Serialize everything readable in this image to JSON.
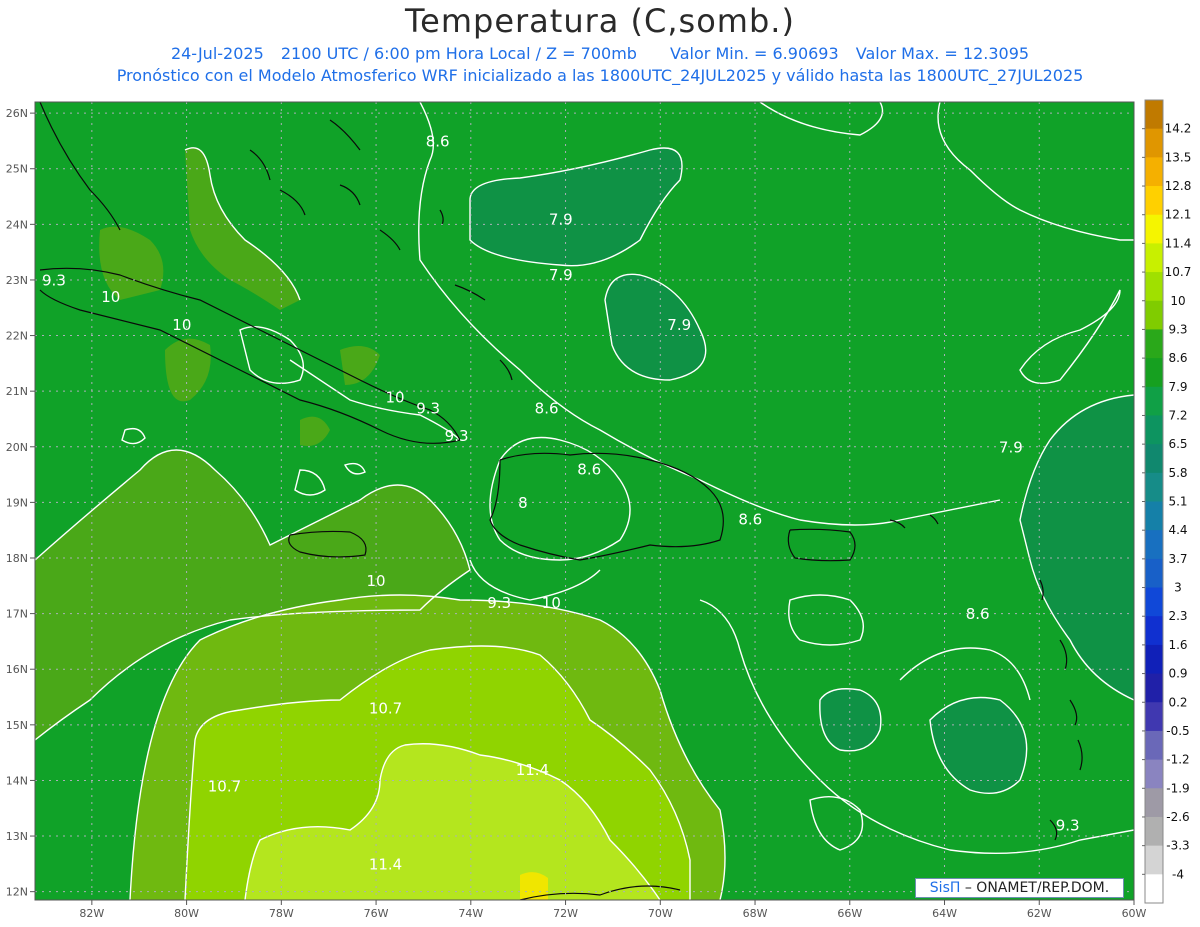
{
  "title": "Temperatura (C,somb.)",
  "subtitle": {
    "date": "24-Jul-2025",
    "time": "2100 UTC / 6:00 pm Hora Local / Z = 700mb",
    "min": "Valor Min. = 6.90693",
    "max": "Valor Max. = 12.3095"
  },
  "forecast_line": "Pronóstico con el Modelo Atmosferico WRF inicializado a las 1800UTC_24JUL2025 y válido hasta las  1800UTC_27JUL2025",
  "credit": {
    "brand": "SisΠ",
    "text": "– ONAMET/REP.DOM."
  },
  "axes": {
    "lat_labels": [
      "26N",
      "25N",
      "24N",
      "23N",
      "22N",
      "21N",
      "20N",
      "19N",
      "18N",
      "17N",
      "16N",
      "15N",
      "14N",
      "13N",
      "12N"
    ],
    "lon_labels": [
      "82W",
      "80W",
      "78W",
      "76W",
      "74W",
      "72W",
      "70W",
      "68W",
      "66W",
      "64W",
      "62W",
      "60W"
    ]
  },
  "colorbar": {
    "labels": [
      "14.2",
      "13.5",
      "12.8",
      "12.1",
      "11.4",
      "10.7",
      "10",
      "9.3",
      "8.6",
      "7.9",
      "7.2",
      "6.5",
      "5.8",
      "5.1",
      "4.4",
      "3.7",
      "3",
      "2.3",
      "1.6",
      "0.9",
      "0.2",
      "-0.5",
      "-1.2",
      "-1.9",
      "-2.6",
      "-3.3",
      "-4"
    ],
    "colors": [
      "#c07a00",
      "#e09600",
      "#f5b000",
      "#ffd000",
      "#f5f500",
      "#c8f000",
      "#a0e000",
      "#80cc00",
      "#2aa81a",
      "#16a020",
      "#10a046",
      "#0d9460",
      "#10886e",
      "#168c88",
      "#1580a8",
      "#1870c0",
      "#1860c8",
      "#1048d8",
      "#1030d0",
      "#1020b8",
      "#2020a8",
      "#4038b0",
      "#6a68b8",
      "#8a84c0",
      "#9e9aa6",
      "#b0b0b0",
      "#d4d4d4",
      "#ffffff"
    ]
  },
  "contour_labels": [
    {
      "text": "8.6",
      "lon": -74.7,
      "lat": 25.4
    },
    {
      "text": "7.9",
      "lon": -72.1,
      "lat": 24.0
    },
    {
      "text": "7.9",
      "lon": -72.1,
      "lat": 23.0
    },
    {
      "text": "7.9",
      "lon": -69.6,
      "lat": 22.1
    },
    {
      "text": "9.3",
      "lon": -82.8,
      "lat": 22.9
    },
    {
      "text": "10",
      "lon": -81.6,
      "lat": 22.6
    },
    {
      "text": "10",
      "lon": -80.1,
      "lat": 22.1
    },
    {
      "text": "10",
      "lon": -75.6,
      "lat": 20.8
    },
    {
      "text": "9.3",
      "lon": -74.9,
      "lat": 20.6
    },
    {
      "text": "8.6",
      "lon": -72.4,
      "lat": 20.6
    },
    {
      "text": "9.3",
      "lon": -74.3,
      "lat": 20.1
    },
    {
      "text": "8.6",
      "lon": -71.5,
      "lat": 19.5
    },
    {
      "text": "8",
      "lon": -72.9,
      "lat": 18.9
    },
    {
      "text": "8.6",
      "lon": -68.1,
      "lat": 18.6
    },
    {
      "text": "10",
      "lon": -76.0,
      "lat": 17.5
    },
    {
      "text": "9.3",
      "lon": -73.4,
      "lat": 17.1
    },
    {
      "text": "10",
      "lon": -72.3,
      "lat": 17.1
    },
    {
      "text": "7.9",
      "lon": -62.6,
      "lat": 19.9
    },
    {
      "text": "8.6",
      "lon": -63.3,
      "lat": 16.9
    },
    {
      "text": "10.7",
      "lon": -75.8,
      "lat": 15.2
    },
    {
      "text": "11.4",
      "lon": -72.7,
      "lat": 14.1
    },
    {
      "text": "10.7",
      "lon": -79.2,
      "lat": 13.8
    },
    {
      "text": "11.4",
      "lon": -75.8,
      "lat": 12.4
    },
    {
      "text": "9.3",
      "lon": -61.4,
      "lat": 13.1
    }
  ]
}
